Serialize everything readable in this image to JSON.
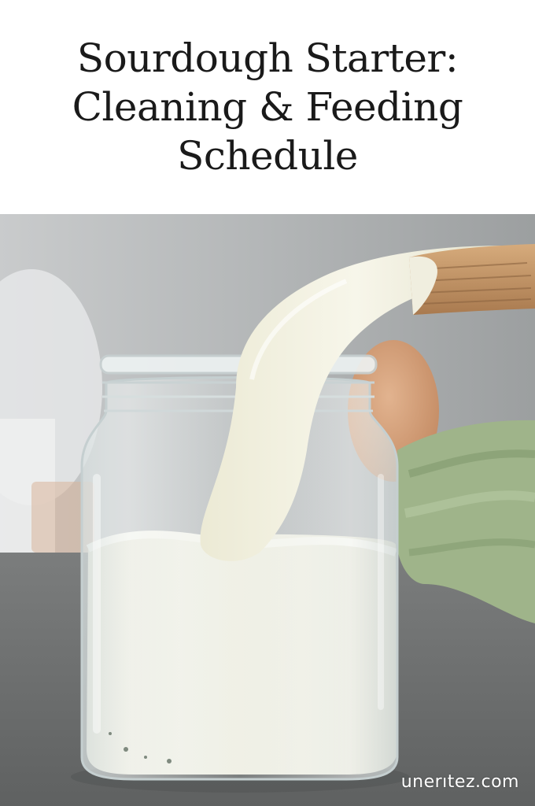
{
  "title": {
    "line1": "Sourdough Starter:",
    "line2": "Cleaning & Feeding",
    "line3": "Schedule"
  },
  "watermark": "unerıtez.com",
  "colors": {
    "background_top": "#ffffff",
    "backdrop": "#b9bcbd",
    "countertop": "#6e7070",
    "starter": "#f1efe0",
    "towel": "#9fb48a",
    "spoon_handle": "#c79a6b"
  }
}
